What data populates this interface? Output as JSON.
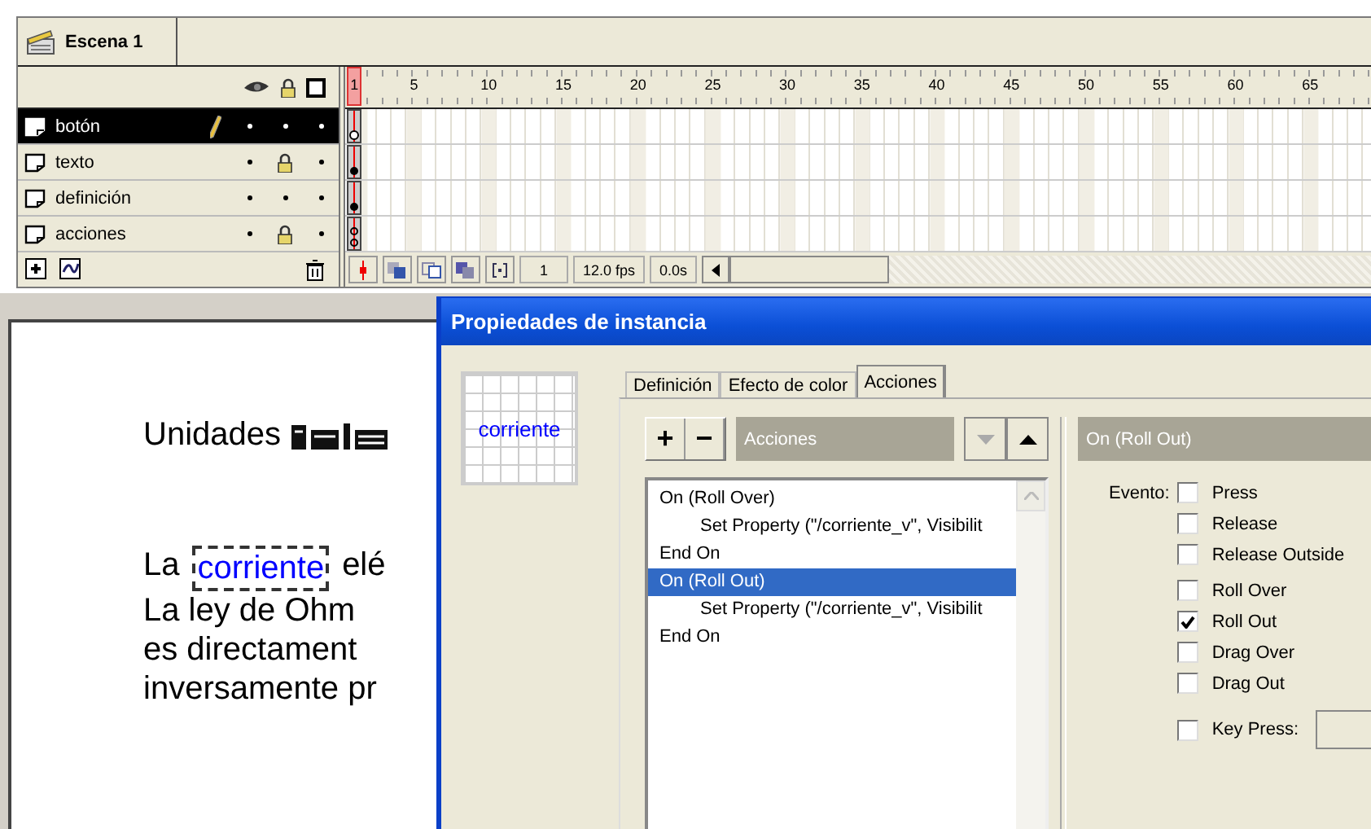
{
  "scene": {
    "label": "Escena 1"
  },
  "timeline": {
    "ruler": [
      "1",
      "5",
      "10",
      "15",
      "20",
      "25",
      "30",
      "35",
      "40",
      "45",
      "50",
      "55",
      "60",
      "65"
    ],
    "layers": [
      {
        "name": "botón",
        "selected": true,
        "editing": true,
        "visible": true,
        "locked": false,
        "keyframe": {
          "kind": "blank"
        }
      },
      {
        "name": "texto",
        "selected": false,
        "editing": false,
        "visible": true,
        "locked": true,
        "keyframe": {
          "kind": "filled"
        }
      },
      {
        "name": "definición",
        "selected": false,
        "editing": false,
        "visible": true,
        "locked": false,
        "keyframe": {
          "kind": "filled"
        }
      },
      {
        "name": "acciones",
        "selected": false,
        "editing": false,
        "visible": true,
        "locked": true,
        "keyframe": {
          "kind": "actions"
        }
      }
    ],
    "frame": "1",
    "rate": "12.0 fps",
    "time": "0.0s"
  },
  "stage": {
    "heading": "Unidades",
    "lines": [
      {
        "before": "La",
        "instance": "corriente",
        "after": "elé"
      },
      {
        "before": "La ley de Ohm"
      },
      {
        "before": "es directament"
      },
      {
        "before": "inversamente pr"
      }
    ]
  },
  "dialog": {
    "title": "Propiedades de instancia",
    "preview": "corriente",
    "tabs": [
      {
        "label": "Definición",
        "selected": false
      },
      {
        "label": "Efecto de color",
        "selected": false
      },
      {
        "label": "Acciones",
        "selected": true
      }
    ],
    "add": "+",
    "remove": "−",
    "category": "Acciones",
    "actions": [
      {
        "text": "On (Roll Over)",
        "selected": false,
        "children": [
          {
            "text": "Set Property (\"/corriente_v\", Visibilit",
            "selected": false
          }
        ],
        "end": "End On"
      },
      {
        "text": "On (Roll Out)",
        "selected": true,
        "children": [
          {
            "text": "Set Property (\"/corriente_v\", Visibilit",
            "selected": false
          }
        ],
        "end": "End On"
      }
    ],
    "event_title": "On (Roll Out)",
    "event_label": "Evento:",
    "event_groups": [
      {
        "events": [
          {
            "label": "Press",
            "checked": false
          },
          {
            "label": "Release",
            "checked": false
          },
          {
            "label": "Release Outside",
            "checked": false
          }
        ]
      },
      {
        "events": [
          {
            "label": "Roll Over",
            "checked": false
          },
          {
            "label": "Roll Out",
            "checked": true
          },
          {
            "label": "Drag Over",
            "checked": false
          },
          {
            "label": "Drag Out",
            "checked": false
          }
        ]
      }
    ],
    "key_press": {
      "label": "Key Press:",
      "checked": false
    }
  }
}
